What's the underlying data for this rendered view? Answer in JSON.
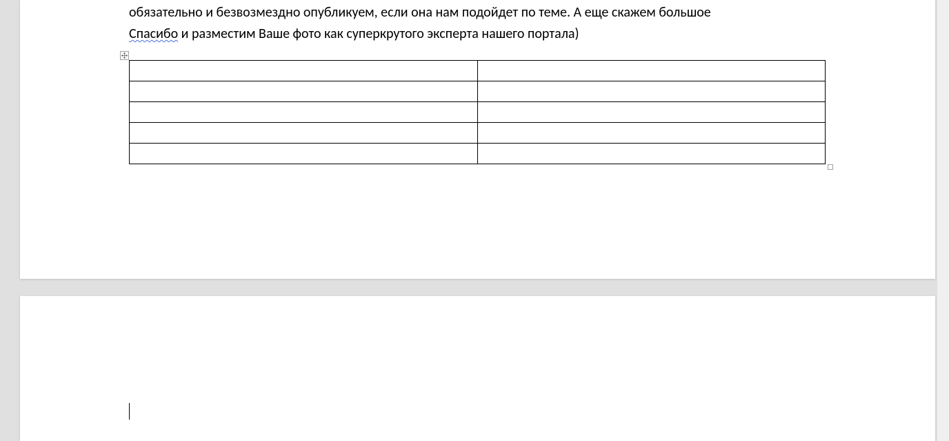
{
  "document": {
    "paragraph": {
      "line1": "обязательно и безвозмездно опубликуем, если она нам подойдет по теме. А еще скажем большое ",
      "squiggle_word": "Спасибо",
      "line2_rest": " и разместим Ваше фото как суперкрутого эксперта нашего портала)"
    },
    "table": {
      "rows": [
        {
          "c1": "",
          "c2": ""
        },
        {
          "c1": "",
          "c2": ""
        },
        {
          "c1": "",
          "c2": ""
        },
        {
          "c1": "",
          "c2": ""
        },
        {
          "c1": "",
          "c2": ""
        }
      ]
    }
  }
}
